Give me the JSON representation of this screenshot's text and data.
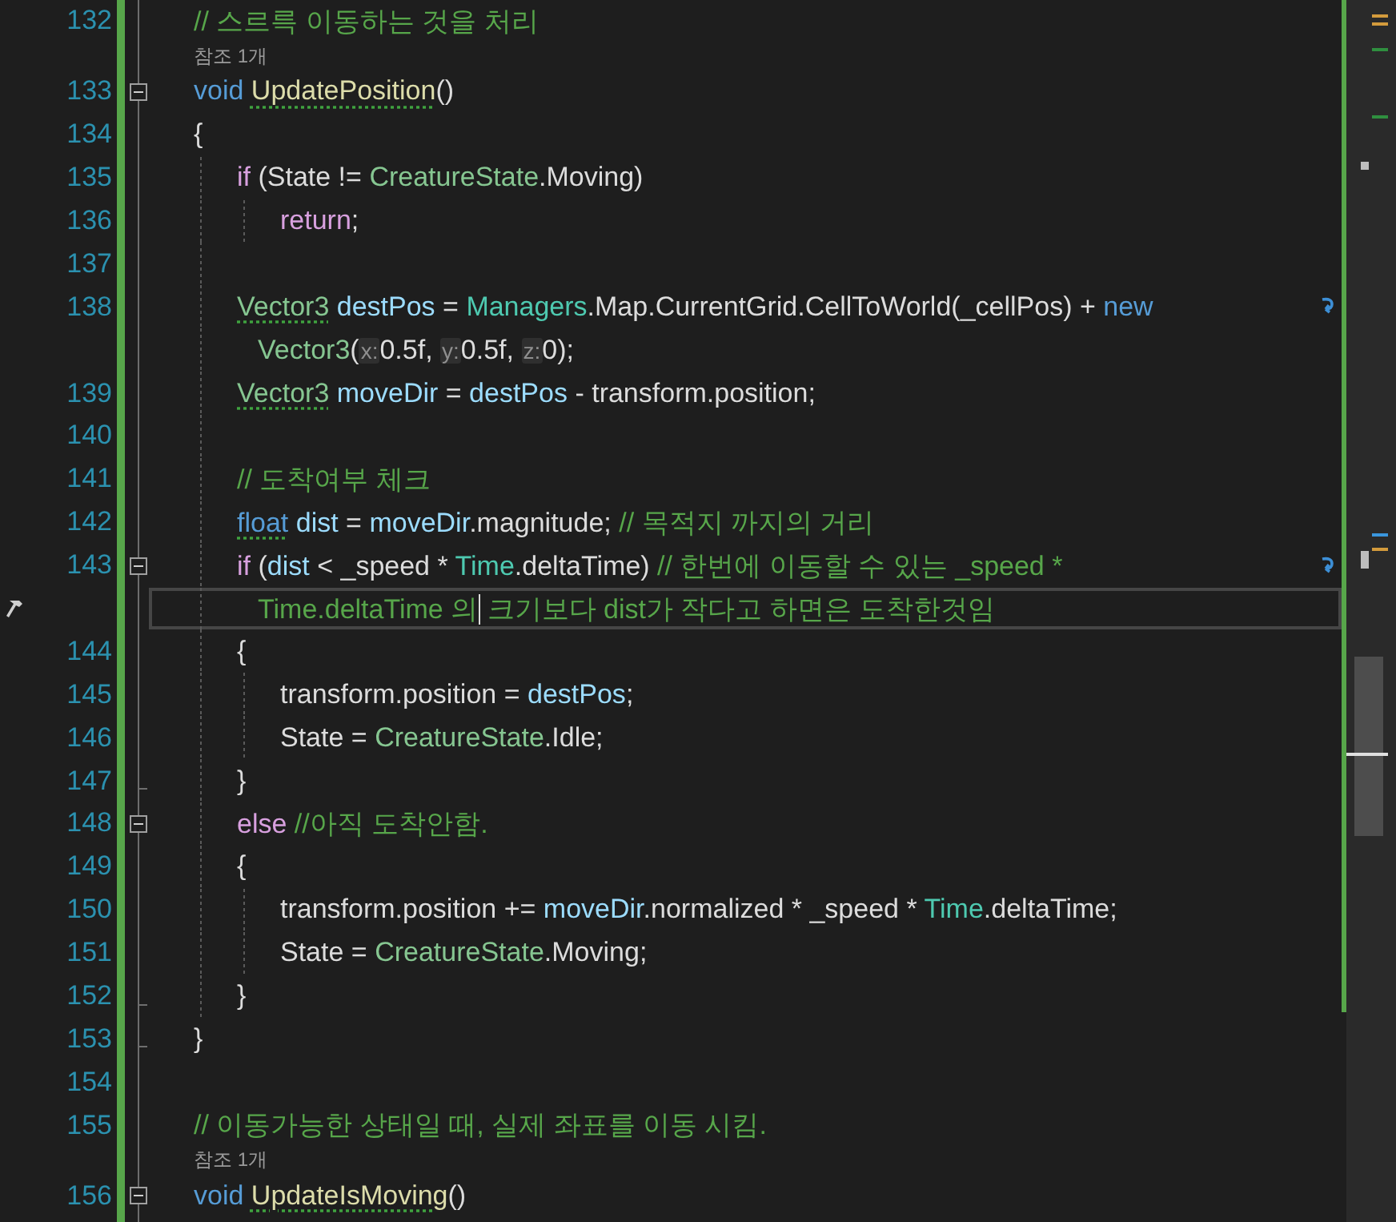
{
  "editor": {
    "rows": [
      {
        "kind": "code",
        "number": "132",
        "tokens": [
          {
            "kind": "comment",
            "text": "// 스르륵 이동하는 것을 처리"
          }
        ]
      },
      {
        "kind": "codelens",
        "text": "참조 1개"
      },
      {
        "kind": "code",
        "number": "133",
        "fold_start": true,
        "tokens": [
          {
            "kind": "keyword",
            "text": "void "
          },
          {
            "kind": "method",
            "text": "UpdatePosition",
            "squiggle": true
          },
          {
            "kind": "plain",
            "text": "()"
          }
        ]
      },
      {
        "kind": "code",
        "number": "134",
        "tokens": [
          {
            "kind": "plain",
            "text": "{"
          }
        ],
        "children": [
          {
            "kind": "code",
            "number": "135",
            "tokens": [
              {
                "kind": "control",
                "text": "if"
              },
              {
                "kind": "plain",
                "text": " (State != "
              },
              {
                "kind": "struct",
                "text": "CreatureState"
              },
              {
                "kind": "plain",
                "text": ".Moving)"
              }
            ],
            "children": [
              {
                "kind": "code",
                "number": "136",
                "tokens": [
                  {
                    "kind": "control",
                    "text": "return"
                  },
                  {
                    "kind": "plain",
                    "text": ";"
                  }
                ]
              }
            ]
          },
          {
            "kind": "code",
            "number": "137"
          },
          {
            "kind": "code",
            "number": "138",
            "tokens": [
              {
                "kind": "struct",
                "text": "Vector3",
                "squiggle": true
              },
              {
                "kind": "variable",
                "text": " destPos"
              },
              {
                "kind": "plain",
                "text": " = "
              },
              {
                "kind": "class",
                "text": "Managers"
              },
              {
                "kind": "plain",
                "text": ".Map.CurrentGrid.CellToWorld(_cellPos) + "
              },
              {
                "kind": "keyword",
                "text": "new"
              }
            ],
            "continuation": {
              "tokens": [
                {
                  "kind": "struct",
                  "text": "Vector3"
                },
                {
                  "kind": "plain",
                  "text": "("
                },
                {
                  "kind": "hint",
                  "text": "x:"
                },
                {
                  "kind": "plain",
                  "text": "0.5f, "
                },
                {
                  "kind": "hint",
                  "text": "y:"
                },
                {
                  "kind": "plain",
                  "text": "0.5f, "
                },
                {
                  "kind": "hint",
                  "text": "z:"
                },
                {
                  "kind": "plain",
                  "text": "0);"
                }
              ]
            }
          },
          {
            "kind": "code",
            "number": "139",
            "tokens": [
              {
                "kind": "struct",
                "text": "Vector3",
                "squiggle": true
              },
              {
                "kind": "variable",
                "text": " moveDir"
              },
              {
                "kind": "plain",
                "text": " = "
              },
              {
                "kind": "variable",
                "text": "destPos"
              },
              {
                "kind": "plain",
                "text": " - transform.position;"
              }
            ]
          },
          {
            "kind": "code",
            "number": "140"
          },
          {
            "kind": "code",
            "number": "141",
            "tokens": [
              {
                "kind": "comment",
                "text": "// 도착여부 체크"
              }
            ]
          },
          {
            "kind": "code",
            "number": "142",
            "tokens": [
              {
                "kind": "keyword",
                "text": "float",
                "squiggle": true
              },
              {
                "kind": "variable",
                "text": " dist"
              },
              {
                "kind": "plain",
                "text": " = "
              },
              {
                "kind": "variable",
                "text": "moveDir"
              },
              {
                "kind": "plain",
                "text": ".magnitude; "
              },
              {
                "kind": "comment",
                "text": "// 목적지 까지의 거리"
              }
            ]
          },
          {
            "kind": "code",
            "number": "143",
            "fold_start": true,
            "tokens": [
              {
                "kind": "control",
                "text": "if"
              },
              {
                "kind": "plain",
                "text": " ("
              },
              {
                "kind": "variable",
                "text": "dist"
              },
              {
                "kind": "plain",
                "text": " < _speed * "
              },
              {
                "kind": "class",
                "text": "Time"
              },
              {
                "kind": "plain",
                "text": ".deltaTime) "
              },
              {
                "kind": "comment",
                "text": "// 한번에 이동할 수 있는 _speed *"
              }
            ],
            "continuation": {
              "current": true,
              "build_glyph": true,
              "tokens": [
                {
                  "kind": "comment",
                  "text": "Time.deltaTime 의"
                },
                {
                  "kind": "comment",
                  "text": " 크기보다 dist가 작다고 하면은 도착한것임",
                  "caret": true
                }
              ]
            }
          },
          {
            "kind": "code",
            "number": "144",
            "tokens": [
              {
                "kind": "plain",
                "text": "{"
              }
            ],
            "children": [
              {
                "kind": "code",
                "number": "145",
                "tokens": [
                  {
                    "kind": "plain",
                    "text": "transform.position = "
                  },
                  {
                    "kind": "variable",
                    "text": "destPos"
                  },
                  {
                    "kind": "plain",
                    "text": ";"
                  }
                ]
              },
              {
                "kind": "code",
                "number": "146",
                "tokens": [
                  {
                    "kind": "plain",
                    "text": "State = "
                  },
                  {
                    "kind": "struct",
                    "text": "CreatureState"
                  },
                  {
                    "kind": "plain",
                    "text": ".Idle;"
                  }
                ]
              }
            ]
          },
          {
            "kind": "code",
            "number": "147",
            "fold_end": true,
            "tokens": [
              {
                "kind": "plain",
                "text": "}"
              }
            ]
          },
          {
            "kind": "code",
            "number": "148",
            "fold_start": true,
            "tokens": [
              {
                "kind": "control",
                "text": "else "
              },
              {
                "kind": "comment",
                "text": "//아직 도착안함."
              }
            ]
          },
          {
            "kind": "code",
            "number": "149",
            "tokens": [
              {
                "kind": "plain",
                "text": "{"
              }
            ],
            "children": [
              {
                "kind": "code",
                "number": "150",
                "tokens": [
                  {
                    "kind": "plain",
                    "text": "transform.position += "
                  },
                  {
                    "kind": "variable",
                    "text": "moveDir"
                  },
                  {
                    "kind": "plain",
                    "text": ".normalized * _speed * "
                  },
                  {
                    "kind": "class",
                    "text": "Time"
                  },
                  {
                    "kind": "plain",
                    "text": ".deltaTime;"
                  }
                ]
              },
              {
                "kind": "code",
                "number": "151",
                "tokens": [
                  {
                    "kind": "plain",
                    "text": "State = "
                  },
                  {
                    "kind": "struct",
                    "text": "CreatureState"
                  },
                  {
                    "kind": "plain",
                    "text": ".Moving;"
                  }
                ]
              }
            ]
          },
          {
            "kind": "code",
            "number": "152",
            "fold_end": true,
            "tokens": [
              {
                "kind": "plain",
                "text": "}"
              }
            ]
          }
        ]
      },
      {
        "kind": "code",
        "number": "153",
        "fold_end": true,
        "tokens": [
          {
            "kind": "plain",
            "text": "}"
          }
        ]
      },
      {
        "kind": "code",
        "number": "154"
      },
      {
        "kind": "code",
        "number": "155",
        "tokens": [
          {
            "kind": "comment",
            "text": "// 이동가능한 상태일 때, 실제 좌표를 이동 시킴."
          }
        ]
      },
      {
        "kind": "codelens",
        "text": "참조 1개"
      },
      {
        "kind": "code",
        "number": "156",
        "fold_start": true,
        "tokens": [
          {
            "kind": "keyword",
            "text": "void "
          },
          {
            "kind": "method",
            "text": "UpdateIsMoving",
            "squiggle": true
          },
          {
            "kind": "plain",
            "text": "()"
          }
        ]
      }
    ]
  }
}
